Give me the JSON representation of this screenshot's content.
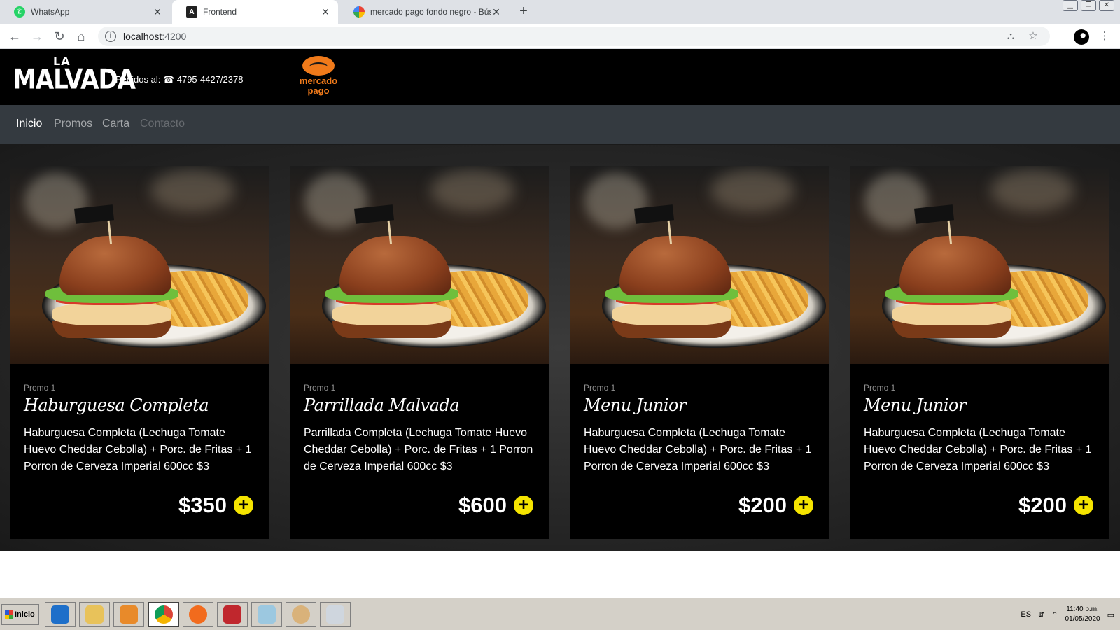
{
  "browser": {
    "tabs": [
      {
        "title": "WhatsApp",
        "active": false
      },
      {
        "title": "Frontend",
        "active": true
      },
      {
        "title": "mercado pago fondo negro - Búsqu",
        "active": false
      }
    ],
    "url_host": "localhost",
    "url_port": ":4200"
  },
  "site": {
    "logo_line1": "LA",
    "logo_line2": "MALVADA",
    "phone_label": "Pedidos al: ☎ 4795-4427/2378",
    "payment_line1": "mercado",
    "payment_line2": "pago",
    "nav": [
      "Inicio",
      "Promos",
      "Carta",
      "Contacto"
    ]
  },
  "cards": [
    {
      "kicker": "Promo 1",
      "title": "Haburguesa Completa",
      "description": "Haburguesa Completa (Lechuga Tomate Huevo Cheddar Cebolla) + Porc. de Fritas + 1 Porron de Cerveza Imperial 600cc $3",
      "price": "$350"
    },
    {
      "kicker": "Promo 1",
      "title": "Parrillada Malvada",
      "description": "Parrillada Completa (Lechuga Tomate Huevo Cheddar Cebolla) + Porc. de Fritas + 1 Porron de Cerveza Imperial 600cc $3",
      "price": "$600"
    },
    {
      "kicker": "Promo 1",
      "title": "Menu Junior",
      "description": "Haburguesa Completa (Lechuga Tomate Huevo Cheddar Cebolla) + Porc. de Fritas + 1 Porron de Cerveza Imperial 600cc $3",
      "price": "$200"
    },
    {
      "kicker": "Promo 1",
      "title": "Menu Junior",
      "description": "Haburguesa Completa (Lechuga Tomate Huevo Cheddar Cebolla) + Porc. de Fritas + 1 Porron de Cerveza Imperial 600cc $3",
      "price": "$200"
    }
  ],
  "taskbar": {
    "start_label": "Inicio",
    "lang": "ES",
    "time": "11:40 p.m.",
    "date": "01/05/2020"
  },
  "colors": {
    "add_button": "#f5e400",
    "navbar": "#343a40",
    "mercado_pago": "#f07a1a"
  }
}
